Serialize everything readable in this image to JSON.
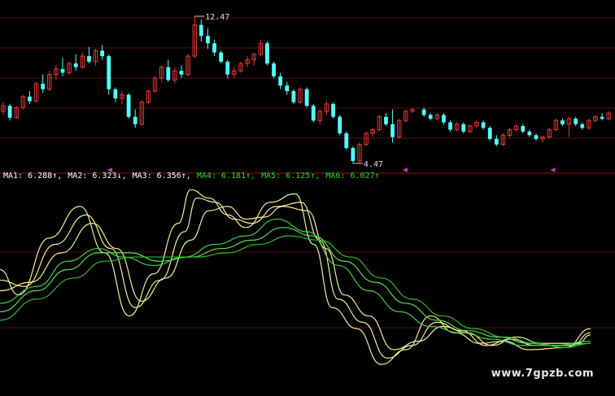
{
  "chart_data": {
    "type": "candlestick",
    "price_panel": {
      "high_label": "12.47",
      "low_label": "4.47",
      "ohlc": [
        [
          7.3,
          7.8,
          7.1,
          7.6
        ],
        [
          7.6,
          7.7,
          6.8,
          6.95
        ],
        [
          6.95,
          7.6,
          6.9,
          7.5
        ],
        [
          7.5,
          8.2,
          7.4,
          8.1
        ],
        [
          8.1,
          8.4,
          7.7,
          7.85
        ],
        [
          7.85,
          8.9,
          7.8,
          8.8
        ],
        [
          8.8,
          9.3,
          8.3,
          8.5
        ],
        [
          8.5,
          9.5,
          8.4,
          9.3
        ],
        [
          9.3,
          9.8,
          9.0,
          9.6
        ],
        [
          9.6,
          10.2,
          9.2,
          9.4
        ],
        [
          9.4,
          10.0,
          9.3,
          9.9
        ],
        [
          9.9,
          10.4,
          9.5,
          9.7
        ],
        [
          9.7,
          10.5,
          9.6,
          10.3
        ],
        [
          10.3,
          10.8,
          9.9,
          10.0
        ],
        [
          10.0,
          10.7,
          9.8,
          10.6
        ],
        [
          10.6,
          10.9,
          10.1,
          10.3
        ],
        [
          10.3,
          10.4,
          8.2,
          8.5
        ],
        [
          8.5,
          8.6,
          7.8,
          8.0
        ],
        [
          8.0,
          8.4,
          7.7,
          8.2
        ],
        [
          8.2,
          8.3,
          6.9,
          7.0
        ],
        [
          7.0,
          7.4,
          6.4,
          6.6
        ],
        [
          6.6,
          7.9,
          6.5,
          7.8
        ],
        [
          7.8,
          8.5,
          7.7,
          8.4
        ],
        [
          8.4,
          9.2,
          8.3,
          9.1
        ],
        [
          9.1,
          9.8,
          8.9,
          9.7
        ],
        [
          9.7,
          10.1,
          8.9,
          9.0
        ],
        [
          9.0,
          9.7,
          8.8,
          9.5
        ],
        [
          9.5,
          9.8,
          9.1,
          9.3
        ],
        [
          9.3,
          10.4,
          9.2,
          10.3
        ],
        [
          10.3,
          12.47,
          10.2,
          12.0
        ],
        [
          12.0,
          12.3,
          11.1,
          11.4
        ],
        [
          11.4,
          11.8,
          10.7,
          11.0
        ],
        [
          11.0,
          11.2,
          10.3,
          10.5
        ],
        [
          10.5,
          10.6,
          9.9,
          10.0
        ],
        [
          10.0,
          10.1,
          9.1,
          9.3
        ],
        [
          9.3,
          9.7,
          9.1,
          9.5
        ],
        [
          9.5,
          10.0,
          9.4,
          9.9
        ],
        [
          9.9,
          10.3,
          9.7,
          10.1
        ],
        [
          10.1,
          10.5,
          9.8,
          10.4
        ],
        [
          10.4,
          11.2,
          10.3,
          11.0
        ],
        [
          11.0,
          11.1,
          9.8,
          9.9
        ],
        [
          9.9,
          10.0,
          9.1,
          9.2
        ],
        [
          9.2,
          9.4,
          8.5,
          8.7
        ],
        [
          8.7,
          8.9,
          8.2,
          8.4
        ],
        [
          8.4,
          8.5,
          7.7,
          7.8
        ],
        [
          7.8,
          8.6,
          7.7,
          8.5
        ],
        [
          8.5,
          8.6,
          7.5,
          7.6
        ],
        [
          7.6,
          7.7,
          6.7,
          6.8
        ],
        [
          6.8,
          7.4,
          6.6,
          7.3
        ],
        [
          7.3,
          7.9,
          7.1,
          7.7
        ],
        [
          7.7,
          7.8,
          6.9,
          7.0
        ],
        [
          7.0,
          7.1,
          6.0,
          6.1
        ],
        [
          6.1,
          6.2,
          5.2,
          5.3
        ],
        [
          5.3,
          5.4,
          4.47,
          4.6
        ],
        [
          4.6,
          5.6,
          4.5,
          5.5
        ],
        [
          5.5,
          6.2,
          5.4,
          6.1
        ],
        [
          6.1,
          6.4,
          5.9,
          6.3
        ],
        [
          6.3,
          7.1,
          6.2,
          7.0
        ],
        [
          7.0,
          7.2,
          6.5,
          6.6
        ],
        [
          6.6,
          7.4,
          5.6,
          5.9
        ],
        [
          5.9,
          6.9,
          5.8,
          6.8
        ],
        [
          6.8,
          7.4,
          6.7,
          7.3
        ],
        [
          7.3,
          7.5,
          7.2,
          7.4
        ],
        [
          7.4,
          7.5,
          7.0,
          7.1
        ],
        [
          7.1,
          7.2,
          6.8,
          6.9
        ],
        [
          6.9,
          7.2,
          6.8,
          7.1
        ],
        [
          7.1,
          7.2,
          6.6,
          6.7
        ],
        [
          6.7,
          6.8,
          6.2,
          6.3
        ],
        [
          6.3,
          6.7,
          6.2,
          6.6
        ],
        [
          6.6,
          6.7,
          6.1,
          6.2
        ],
        [
          6.2,
          6.6,
          6.1,
          6.5
        ],
        [
          6.5,
          6.8,
          6.4,
          6.7
        ],
        [
          6.7,
          6.8,
          6.3,
          6.4
        ],
        [
          6.4,
          6.5,
          5.7,
          5.8
        ],
        [
          5.8,
          6.0,
          5.4,
          5.5
        ],
        [
          5.5,
          6.1,
          5.4,
          6.0
        ],
        [
          6.0,
          6.4,
          5.9,
          6.3
        ],
        [
          6.3,
          6.6,
          6.2,
          6.5
        ],
        [
          6.5,
          6.6,
          6.1,
          6.2
        ],
        [
          6.2,
          6.3,
          5.9,
          6.0
        ],
        [
          6.0,
          6.1,
          5.7,
          5.8
        ],
        [
          5.8,
          6.0,
          5.6,
          5.9
        ],
        [
          5.9,
          6.4,
          5.8,
          6.3
        ],
        [
          6.3,
          6.9,
          6.2,
          6.8
        ],
        [
          6.8,
          6.9,
          6.5,
          6.6
        ],
        [
          6.6,
          7.0,
          5.9,
          6.9
        ],
        [
          6.9,
          7.0,
          6.5,
          6.6
        ],
        [
          6.6,
          6.7,
          6.3,
          6.4
        ],
        [
          6.4,
          6.9,
          6.3,
          6.8
        ],
        [
          6.8,
          7.1,
          6.7,
          7.0
        ],
        [
          7.0,
          7.2,
          6.8,
          6.9
        ],
        [
          6.9,
          7.3,
          6.8,
          7.2
        ]
      ],
      "gap_after_index": 62,
      "yrange": [
        4.2,
        13.0
      ]
    },
    "ma_legend": [
      {
        "label": "MA1: 6.288↑",
        "color": "#ffffff"
      },
      {
        "label": "MA2: 6.323↓",
        "color": "#ffffff"
      },
      {
        "label": "MA3: 6.356↑",
        "color": "#ffffff"
      },
      {
        "label": "MA4: 6.181↑",
        "color": "#22dd22"
      },
      {
        "label": "MA5: 6.125↑",
        "color": "#22dd22"
      },
      {
        "label": "MA6: 6.027↑",
        "color": "#22dd22"
      }
    ],
    "oscillator": {
      "series": [
        {
          "color": "#f4ee9a",
          "x": [
            0,
            3,
            8,
            13,
            17,
            21,
            25,
            29,
            31,
            34,
            37,
            40,
            44,
            48,
            51,
            54,
            58,
            62,
            66,
            70,
            74,
            78,
            82,
            86,
            92,
            96
          ],
          "y": [
            60,
            48,
            75,
            90,
            68,
            38,
            58,
            82,
            98,
            94,
            86,
            80,
            92,
            96,
            72,
            42,
            32,
            15,
            22,
            38,
            30,
            25,
            26,
            22,
            23,
            32
          ]
        },
        {
          "color": "#f4ee9a",
          "x": [
            0,
            4,
            9,
            14,
            18,
            22,
            26,
            30,
            32,
            35,
            38,
            41,
            45,
            49,
            52,
            55,
            59,
            63,
            67,
            71,
            75,
            79,
            83,
            87,
            93,
            96
          ],
          "y": [
            55,
            52,
            72,
            86,
            70,
            42,
            55,
            78,
            94,
            92,
            84,
            82,
            90,
            92,
            74,
            46,
            35,
            18,
            24,
            35,
            31,
            24,
            27,
            24,
            24,
            30
          ]
        },
        {
          "color": "#f4ee9a",
          "x": [
            0,
            5,
            10,
            15,
            19,
            23,
            27,
            31,
            34,
            37,
            40,
            43,
            46,
            50,
            53,
            56,
            60,
            64,
            68,
            72,
            76,
            80,
            84,
            88,
            94,
            96
          ],
          "y": [
            50,
            54,
            68,
            82,
            70,
            45,
            56,
            74,
            88,
            90,
            84,
            85,
            90,
            88,
            70,
            48,
            38,
            22,
            26,
            33,
            30,
            24,
            28,
            25,
            25,
            29
          ]
        },
        {
          "color": "#44d244",
          "x": [
            0,
            6,
            11,
            16,
            20,
            25,
            30,
            35,
            40,
            45,
            50,
            55,
            60,
            65,
            70,
            75,
            80,
            85,
            90,
            96
          ],
          "y": [
            44,
            52,
            64,
            70,
            66,
            62,
            66,
            72,
            76,
            84,
            78,
            62,
            50,
            40,
            33,
            30,
            27,
            24,
            24,
            26
          ]
        },
        {
          "color": "#55e055",
          "x": [
            0,
            6,
            11,
            16,
            21,
            26,
            31,
            36,
            41,
            46,
            51,
            56,
            61,
            66,
            71,
            76,
            81,
            86,
            91,
            96
          ],
          "y": [
            40,
            50,
            60,
            68,
            68,
            64,
            66,
            70,
            74,
            80,
            76,
            64,
            54,
            44,
            36,
            31,
            28,
            25,
            24,
            25
          ]
        },
        {
          "color": "#33b833",
          "x": [
            0,
            6,
            12,
            17,
            22,
            27,
            32,
            37,
            42,
            47,
            52,
            57,
            62,
            67,
            72,
            77,
            82,
            87,
            92,
            96
          ],
          "y": [
            36,
            46,
            56,
            64,
            66,
            66,
            66,
            68,
            72,
            76,
            74,
            66,
            56,
            46,
            38,
            32,
            28,
            25,
            23,
            25
          ]
        }
      ]
    },
    "watermark": "www.7gpzb.com"
  }
}
